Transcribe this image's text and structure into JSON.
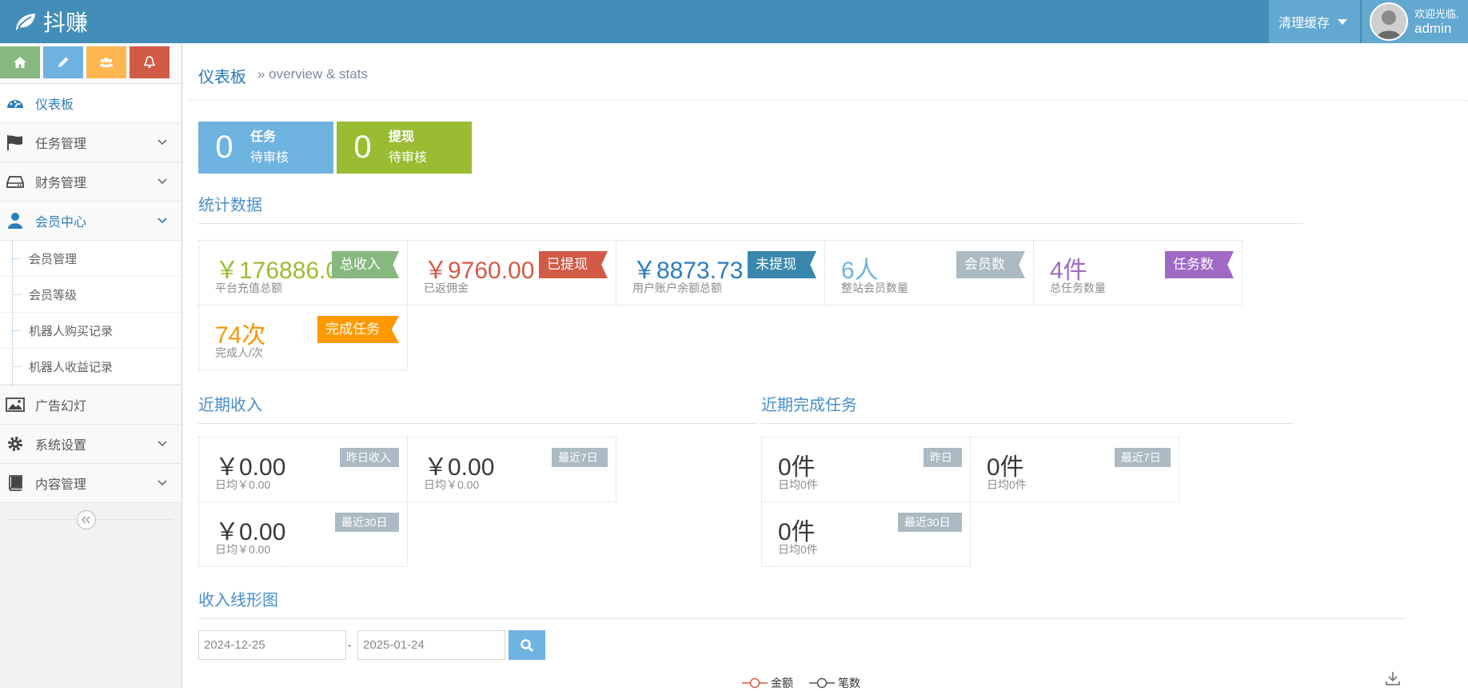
{
  "brand": {
    "name": "抖赚"
  },
  "navbar": {
    "clear_cache": "清理缓存",
    "welcome": "欢迎光临,",
    "username": "admin"
  },
  "sidebar": {
    "items": [
      {
        "label": "仪表板",
        "icon": "tachometer-icon",
        "active": true
      },
      {
        "label": "任务管理",
        "icon": "flag-icon"
      },
      {
        "label": "财务管理",
        "icon": "hdd-icon"
      },
      {
        "label": "会员中心",
        "icon": "user-icon",
        "open": true
      },
      {
        "label": "广告幻灯",
        "icon": "picture-icon"
      },
      {
        "label": "系统设置",
        "icon": "cog-icon"
      },
      {
        "label": "内容管理",
        "icon": "book-icon"
      }
    ],
    "submenu": [
      "会员管理",
      "会员等级",
      "机器人购买记录",
      "机器人收益记录"
    ]
  },
  "page": {
    "title": "仪表板",
    "subtitle": "» overview & stats"
  },
  "pending": [
    {
      "count": "0",
      "title": "任务",
      "sub": "待审核",
      "color": "#6fb3e0"
    },
    {
      "count": "0",
      "title": "提现",
      "sub": "待审核",
      "color": "#9abc32"
    }
  ],
  "stats": {
    "title": "统计数据",
    "cards": [
      {
        "value": "￥176886.00",
        "label": "平台充值总额",
        "ribbon": "总收入",
        "value_color": "#9abc32",
        "ribbon_color": "#87b87f"
      },
      {
        "value": "￥9760.00",
        "label": "已返佣金",
        "ribbon": "已提现",
        "value_color": "#d15b47",
        "ribbon_color": "#d15b47"
      },
      {
        "value": "￥8873.73",
        "label": "用户账户余额总额",
        "ribbon": "未提现",
        "value_color": "#2b7dbc",
        "ribbon_color": "#3a87ad"
      },
      {
        "value": "6人",
        "label": "整站会员数量",
        "ribbon": "会员数",
        "value_color": "#6fb3e0",
        "ribbon_color": "#abbac3"
      },
      {
        "value": "4件",
        "label": "总任务数量",
        "ribbon": "任务数",
        "value_color": "#a069c3",
        "ribbon_color": "#a069c3"
      },
      {
        "value": "74次",
        "label": "完成人/次",
        "ribbon": "完成任务",
        "value_color": "#f89406",
        "ribbon_color": "#ff9900"
      }
    ]
  },
  "income": {
    "title": "近期收入",
    "cards": [
      {
        "value": "￥0.00",
        "sub": "日均￥0.00",
        "tag": "昨日收入"
      },
      {
        "value": "￥0.00",
        "sub": "日均￥0.00",
        "tag": "最近7日"
      },
      {
        "value": "￥0.00",
        "sub": "日均￥0.00",
        "tag": "最近30日"
      }
    ]
  },
  "tasks": {
    "title": "近期完成任务",
    "cards": [
      {
        "value": "0件",
        "sub": "日均0件",
        "tag": "昨日"
      },
      {
        "value": "0件",
        "sub": "日均0件",
        "tag": "最近7日"
      },
      {
        "value": "0件",
        "sub": "日均0件",
        "tag": "最近30日"
      }
    ]
  },
  "chart": {
    "title": "收入线形图",
    "date_from": "2024-12-25",
    "date_sep": "-",
    "date_to": "2025-01-24",
    "legend": [
      {
        "name": "金额",
        "color": "#d15b47"
      },
      {
        "name": "笔数",
        "color": "#555555"
      }
    ]
  }
}
